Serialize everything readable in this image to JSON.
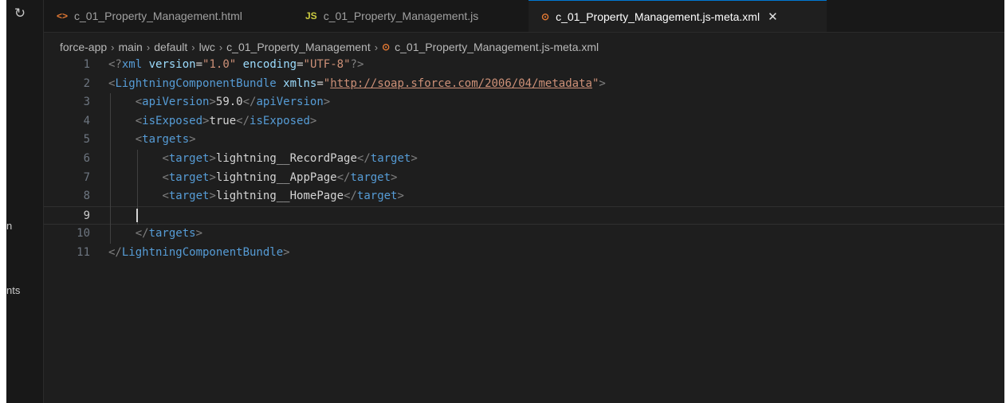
{
  "sidebar": {
    "fragment1": "n",
    "fragment2": "nts"
  },
  "tabs": [
    {
      "icon": "<>",
      "label": "c_01_Property_Management.html",
      "color": "#e37933"
    },
    {
      "icon": "JS",
      "label": "c_01_Property_Management.js",
      "color": "#cbcb41"
    },
    {
      "icon": "€",
      "label": "c_01_Property_Management.js-meta.xml",
      "color": "#e37933",
      "active": true,
      "close": "✕"
    }
  ],
  "breadcrumb": [
    "force-app",
    "main",
    "default",
    "lwc",
    "c_01_Property_Management",
    "c_01_Property_Management.js-meta.xml"
  ],
  "editor": {
    "current_line": 9,
    "lines": [
      {
        "n": "1",
        "text": "<?xml version=\"1.0\" encoding=\"UTF-8\"?>"
      },
      {
        "n": "2",
        "text": "<LightningComponentBundle xmlns=\"http://soap.sforce.com/2006/04/metadata\">"
      },
      {
        "n": "3",
        "text": "    <apiVersion>59.0</apiVersion>"
      },
      {
        "n": "4",
        "text": "    <isExposed>true</isExposed>"
      },
      {
        "n": "5",
        "text": "    <targets>"
      },
      {
        "n": "6",
        "text": "        <target>lightning__RecordPage</target>"
      },
      {
        "n": "7",
        "text": "        <target>lightning__AppPage</target>"
      },
      {
        "n": "8",
        "text": "        <target>lightning__HomePage</target>"
      },
      {
        "n": "9",
        "text": ""
      },
      {
        "n": "10",
        "text": "    </targets>"
      },
      {
        "n": "11",
        "text": "</LightningComponentBundle>"
      }
    ]
  },
  "colors": {
    "tag": "#569cd6",
    "attribute": "#9cdcfe",
    "string": "#ce9178",
    "text": "#d4d4d4",
    "bracket": "#808080"
  }
}
